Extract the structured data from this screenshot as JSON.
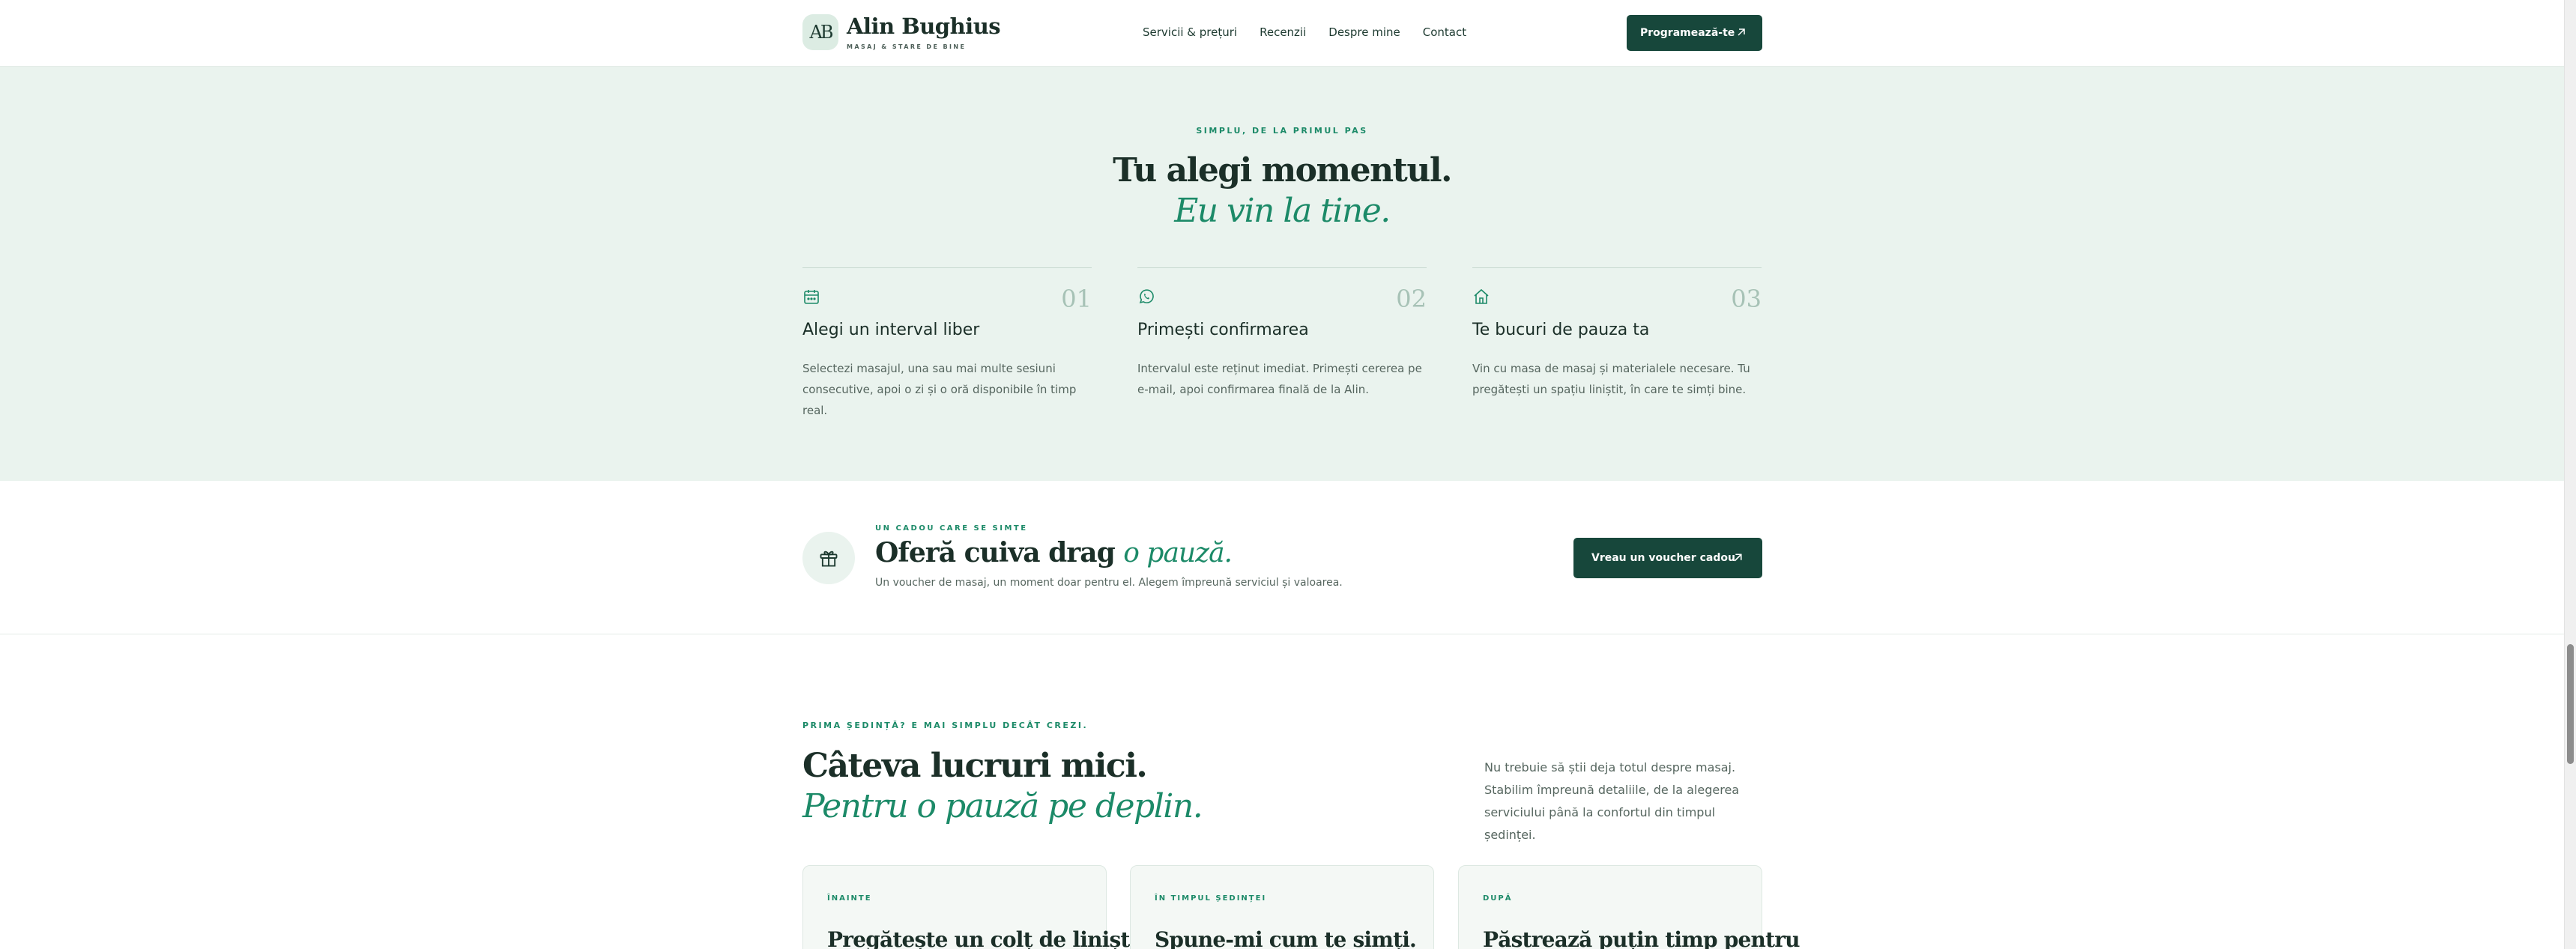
{
  "header": {
    "logo_text": "AB",
    "brand_name": "Alin Bughius",
    "brand_sub": "MASAJ & STARE DE BINE",
    "nav": [
      "Servicii & prețuri",
      "Recenzii",
      "Despre mine",
      "Contact"
    ],
    "cta_label": "Programează-te"
  },
  "steps": {
    "eyebrow": "SIMPLU, DE LA PRIMUL PAS",
    "title": "Tu alegi momentul.",
    "title_accent": "Eu vin la tine.",
    "items": [
      {
        "icon": "calendar-icon",
        "number": "01",
        "title": "Alegi un interval liber",
        "description": "Selectezi masajul, una sau mai multe sesiuni consecutive, apoi o zi și o oră disponibile în timp real."
      },
      {
        "icon": "whatsapp-icon",
        "number": "02",
        "title": "Primești confirmarea",
        "description": "Intervalul este reținut imediat. Primești cererea pe e-mail, apoi confirmarea finală de la Alin."
      },
      {
        "icon": "home-icon",
        "number": "03",
        "title": "Te bucuri de pauza ta",
        "description": "Vin cu masa de masaj și materialele necesare. Tu pregătești un spațiu liniștit, în care te simți bine."
      }
    ]
  },
  "voucher": {
    "eyebrow": "UN CADOU CARE SE SIMTE",
    "title": "Oferă cuiva drag ",
    "title_accent": "o pauză.",
    "description": "Un voucher de masaj, un moment doar pentru el. Alegem împreună serviciul și valoarea.",
    "button_label": "Vreau un voucher cadou"
  },
  "prep": {
    "eyebrow": "PRIMA ȘEDINȚĂ? E MAI SIMPLU DECÂT CREZI.",
    "title": "Câteva lucruri mici.",
    "title_accent": "Pentru o pauză pe deplin.",
    "side_text": "Nu trebuie să știi deja totul despre masaj. Stabilim împreună detaliile, de la alegerea serviciului până la confortul din timpul ședinței.",
    "cards": [
      {
        "eyebrow": "ÎNAINTE",
        "title": "Pregătește un colț de liniște."
      },
      {
        "eyebrow": "ÎN TIMPUL ȘEDINȚEI",
        "title": "Spune-mi cum te simți."
      },
      {
        "eyebrow": "DUPĂ",
        "title": "Păstrează puțin timp pentru"
      }
    ]
  },
  "colors": {
    "primary": "#17473b",
    "accent": "#1c8a68",
    "section_bg": "#eaf3ee"
  }
}
